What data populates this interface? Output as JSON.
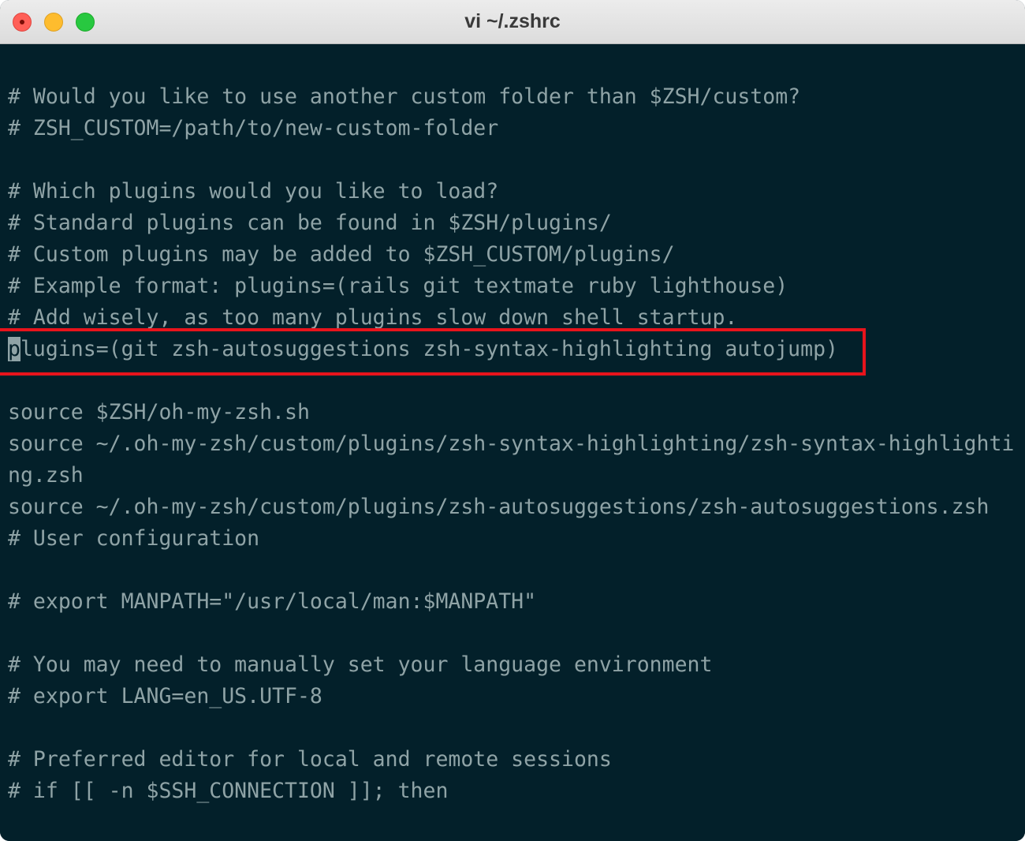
{
  "window": {
    "title": "vi ~/.zshrc"
  },
  "editor": {
    "cursor_char": "p",
    "highlighted_rest": "lugins=(git zsh-autosuggestions zsh-syntax-highlighting autojump)",
    "lines": [
      "# Would you like to use another custom folder than $ZSH/custom?",
      "# ZSH_CUSTOM=/path/to/new-custom-folder",
      "",
      "# Which plugins would you like to load?",
      "# Standard plugins can be found in $ZSH/plugins/",
      "# Custom plugins may be added to $ZSH_CUSTOM/plugins/",
      "# Example format: plugins=(rails git textmate ruby lighthouse)",
      "# Add wisely, as too many plugins slow down shell startup.",
      "plugins=(git zsh-autosuggestions zsh-syntax-highlighting autojump)",
      "",
      "source $ZSH/oh-my-zsh.sh",
      "source ~/.oh-my-zsh/custom/plugins/zsh-syntax-highlighting/zsh-syntax-highlighti",
      "ng.zsh",
      "source ~/.oh-my-zsh/custom/plugins/zsh-autosuggestions/zsh-autosuggestions.zsh",
      "# User configuration",
      "",
      "# export MANPATH=\"/usr/local/man:$MANPATH\"",
      "",
      "# You may need to manually set your language environment",
      "# export LANG=en_US.UTF-8",
      "",
      "# Preferred editor for local and remote sessions",
      "# if [[ -n $SSH_CONNECTION ]]; then"
    ]
  },
  "colors": {
    "background": "#03202a",
    "text": "#8fa3a6",
    "highlight_border": "#e8141c"
  }
}
